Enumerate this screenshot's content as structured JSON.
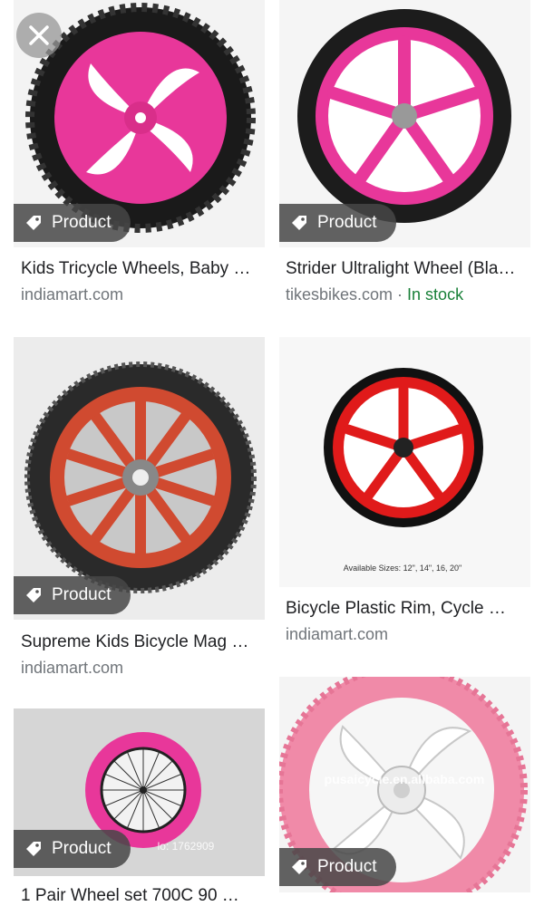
{
  "close": {
    "icon": "close-icon"
  },
  "badge_icon": "tag-icon",
  "cards": [
    {
      "badge": "Product",
      "title": "Kids Tricycle Wheels, Baby …",
      "source": "indiamart.com"
    },
    {
      "badge": "Product",
      "title": "Strider Ultralight Wheel (Bla…",
      "source": "tikesbikes.com",
      "separator": " · ",
      "stock": "In stock"
    },
    {
      "badge": "Product",
      "title": "Supreme Kids Bicycle Mag …",
      "source": "indiamart.com"
    },
    {
      "title": "Bicycle Plastic Rim, Cycle …",
      "source": "indiamart.com",
      "image_caption": "Available Sizes: 12\", 14\", 16, 20\""
    },
    {
      "badge": "Product",
      "title": "1 Pair Wheel set 700C 90 …",
      "image_watermark": "lo: 1762909"
    },
    {
      "badge": "Product",
      "image_watermark": "pusaicycle.en.alibaba.com"
    }
  ],
  "colors": {
    "pink": "#e8379a",
    "red": "#e01a1a",
    "orange_red": "#d04a30",
    "light_pink": "#f08aa8",
    "tire": "#1a1a1a",
    "stock_green": "#188038"
  }
}
